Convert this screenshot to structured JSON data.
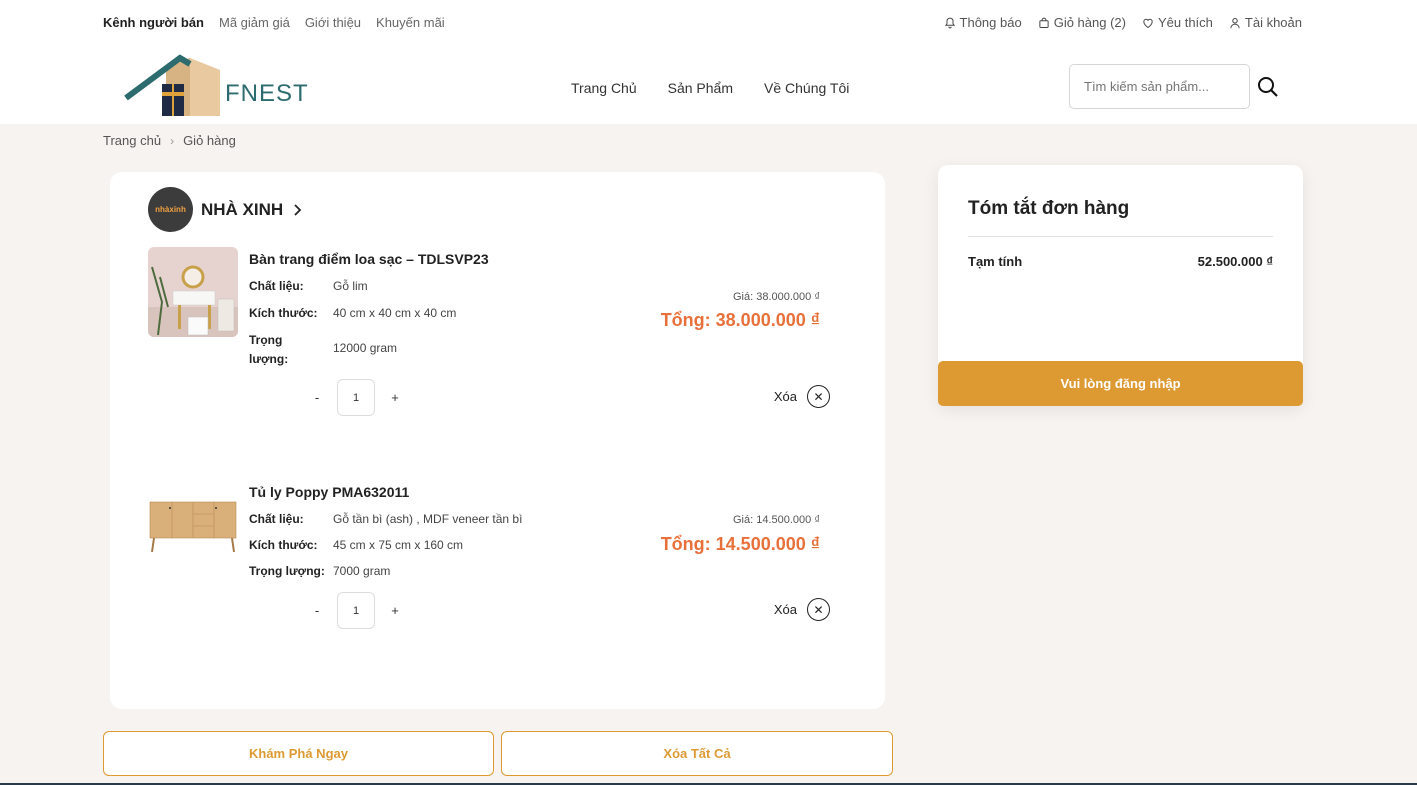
{
  "topbar": {
    "left_links": [
      "Kênh người bán",
      "Mã giảm giá",
      "Giới thiệu",
      "Khuyến mãi"
    ],
    "notifications": "Thông báo",
    "cart": "Giỏ hàng (2)",
    "wishlist": "Yêu thích",
    "account": "Tài khoản"
  },
  "header": {
    "logo_text": "FNEST",
    "nav": [
      "Trang Chủ",
      "Sản Phẩm",
      "Về Chúng Tôi"
    ],
    "search_placeholder": "Tìm kiếm sản phẩm..."
  },
  "breadcrumb": {
    "home": "Trang chủ",
    "current": "Giỏ hàng"
  },
  "shop": {
    "name": "NHÀ XINH",
    "avatar_text": "nhàxinh"
  },
  "products": [
    {
      "name": "Bàn trang điểm loa sạc – TDLSVP23",
      "attrs": [
        {
          "k": "Chất liệu:",
          "v": "Gỗ lim"
        },
        {
          "k": "Kích thước:",
          "v": "40 cm x 40 cm x 40 cm"
        },
        {
          "k": "Trọng lượng:",
          "v": "12000 gram"
        }
      ],
      "price": "Giá: 38.000.000 ₫",
      "total": "Tổng: 38.000.000 ₫",
      "qty": "1",
      "delete": "Xóa"
    },
    {
      "name": "Tủ ly Poppy PMA632011",
      "attrs": [
        {
          "k": "Chất liệu:",
          "v": "Gỗ tần bì (ash) , MDF veneer tần bì"
        },
        {
          "k": "Kích thước:",
          "v": "45 cm x 75 cm x 160 cm"
        },
        {
          "k": "Trọng lượng:",
          "v": "7000 gram"
        }
      ],
      "price": "Giá: 14.500.000 ₫",
      "total": "Tổng: 14.500.000 ₫",
      "qty": "1",
      "delete": "Xóa"
    }
  ],
  "qty_minus": "-",
  "qty_plus": "+",
  "summary": {
    "title": "Tóm tắt đơn hàng",
    "subtotal_label": "Tạm tính",
    "subtotal_value": "52.500.000 ₫",
    "login_button": "Vui lòng đăng nhập"
  },
  "actions": {
    "explore": "Khám Phá Ngay",
    "clear_all": "Xóa Tất Cả"
  },
  "colors": {
    "accent": "#dd9a33",
    "price": "#e8703a",
    "brand": "#2c6b6e",
    "background": "#f7f3f0"
  }
}
